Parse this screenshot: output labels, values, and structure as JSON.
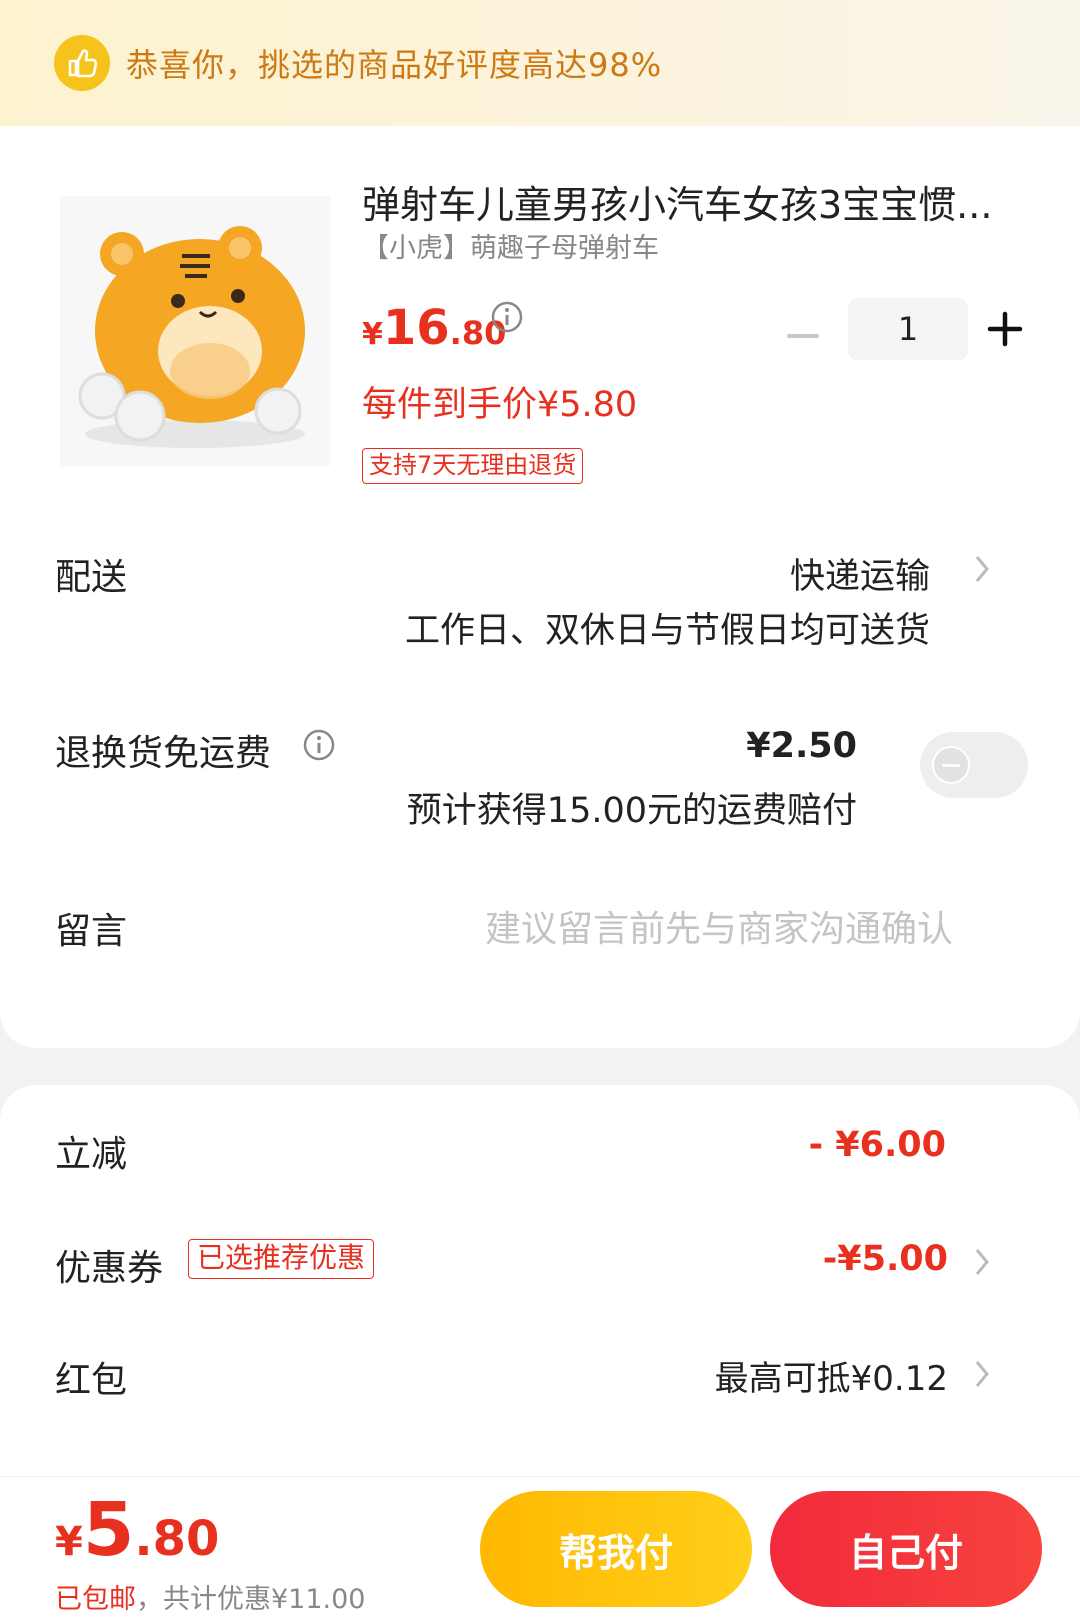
{
  "banner": {
    "text": "恭喜你，挑选的商品好评度高达98%",
    "icon": "thumbs-up-icon",
    "accent": "#f6c21c"
  },
  "product": {
    "title": "弹射车儿童男孩小汽车女孩3宝宝惯...",
    "sku": "【小虎】萌趣子母弹射车",
    "price_symbol": "¥",
    "price_int": "16",
    "price_dec": ".80",
    "quantity": "1",
    "unit_price": "每件到手价¥5.80",
    "return_badge": "支持7天无理由退货",
    "image": "orange-tiger-toy-car"
  },
  "delivery": {
    "label": "配送",
    "method": "快递运输",
    "note": "工作日、双休日与节假日均可送货"
  },
  "return_insurance": {
    "label": "退换货免运费",
    "price": "¥2.50",
    "note": "预计获得15.00元的运费赔付",
    "enabled": false
  },
  "message": {
    "label": "留言",
    "placeholder": "建议留言前先与商家沟通确认"
  },
  "discounts": {
    "instant": {
      "label": "立减",
      "value": "- ¥6.00"
    },
    "coupon": {
      "label": "优惠券",
      "badge": "已选推荐优惠",
      "value": "-¥5.00"
    },
    "red_packet": {
      "label": "红包",
      "value": "最高可抵¥0.12"
    }
  },
  "footer": {
    "total_symbol": "¥",
    "total_int": "5",
    "total_dec": ".80",
    "shipping": "已包邮",
    "savings": "，共计优惠¥11.00",
    "help_pay": "帮我付",
    "self_pay": "自己付",
    "brand_color": "#e8301f"
  }
}
